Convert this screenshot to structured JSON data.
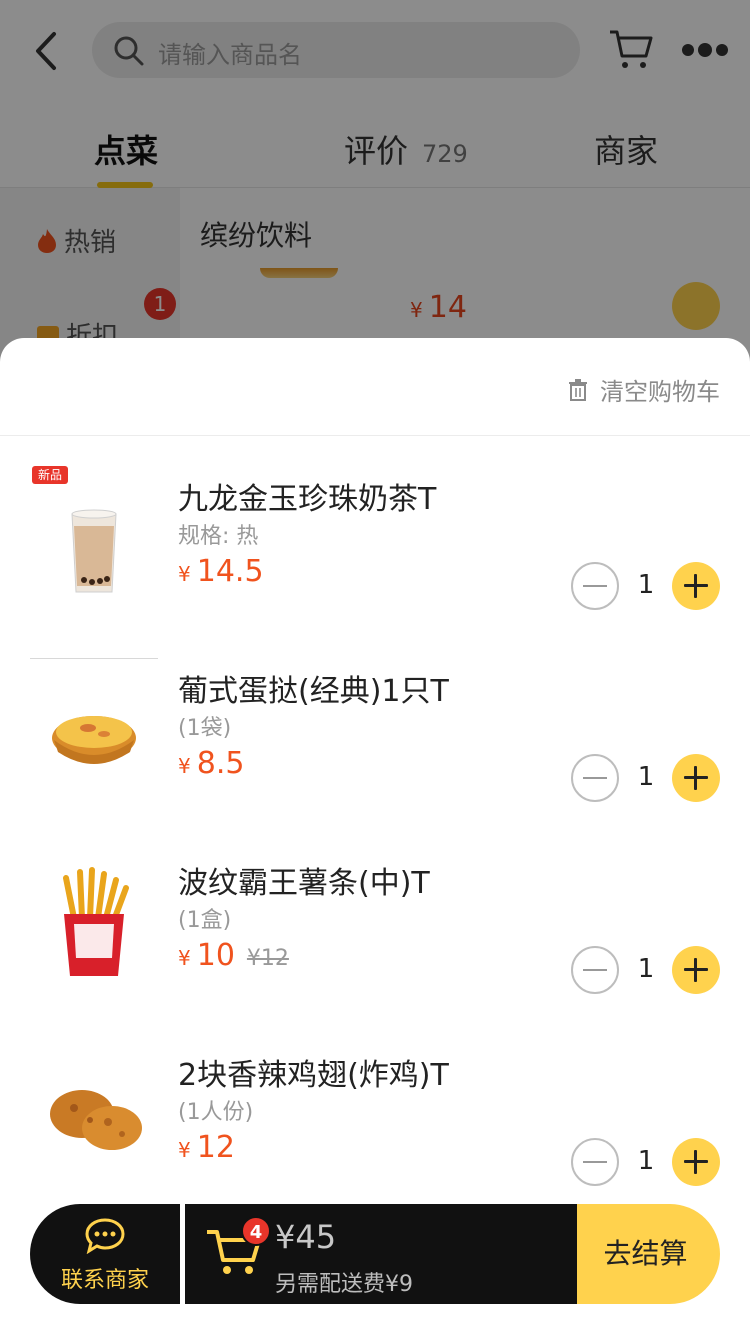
{
  "header": {
    "search_placeholder": "请输入商品名"
  },
  "tabs": [
    {
      "label": "点菜",
      "count": ""
    },
    {
      "label": "评价",
      "count": "729"
    },
    {
      "label": "商家",
      "count": ""
    }
  ],
  "sidebar": {
    "items": [
      {
        "label": "热销"
      },
      {
        "label": "折扣",
        "badge": "1"
      }
    ]
  },
  "section": {
    "title": "缤纷饮料",
    "visible_price_symbol": "¥",
    "visible_price": "14"
  },
  "cart_sheet": {
    "clear_label": "清空购物车",
    "currency": "¥",
    "items": [
      {
        "name": "九龙金玉珍珠奶茶T",
        "spec": "规格: 热",
        "price": "14.5",
        "original_price": "",
        "quantity": "1",
        "tag": "新品"
      },
      {
        "name": "葡式蛋挞(经典)1只T",
        "spec": "(1袋)",
        "price": "8.5",
        "original_price": "",
        "quantity": "1"
      },
      {
        "name": "波纹霸王薯条(中)T",
        "spec": "(1盒)",
        "price": "10",
        "original_price": "¥12",
        "quantity": "1"
      },
      {
        "name": "2块香辣鸡翅(炸鸡)T",
        "spec": "(1人份)",
        "price": "12",
        "original_price": "",
        "quantity": "1"
      }
    ]
  },
  "bottom_bar": {
    "contact_label": "联系商家",
    "cart_count": "4",
    "total": "¥45",
    "delivery_note": "另需配送费¥9",
    "checkout_label": "去结算"
  },
  "colors": {
    "accent_yellow": "#ffd24d",
    "price_red": "#f0531e",
    "badge_red": "#e8352a"
  }
}
